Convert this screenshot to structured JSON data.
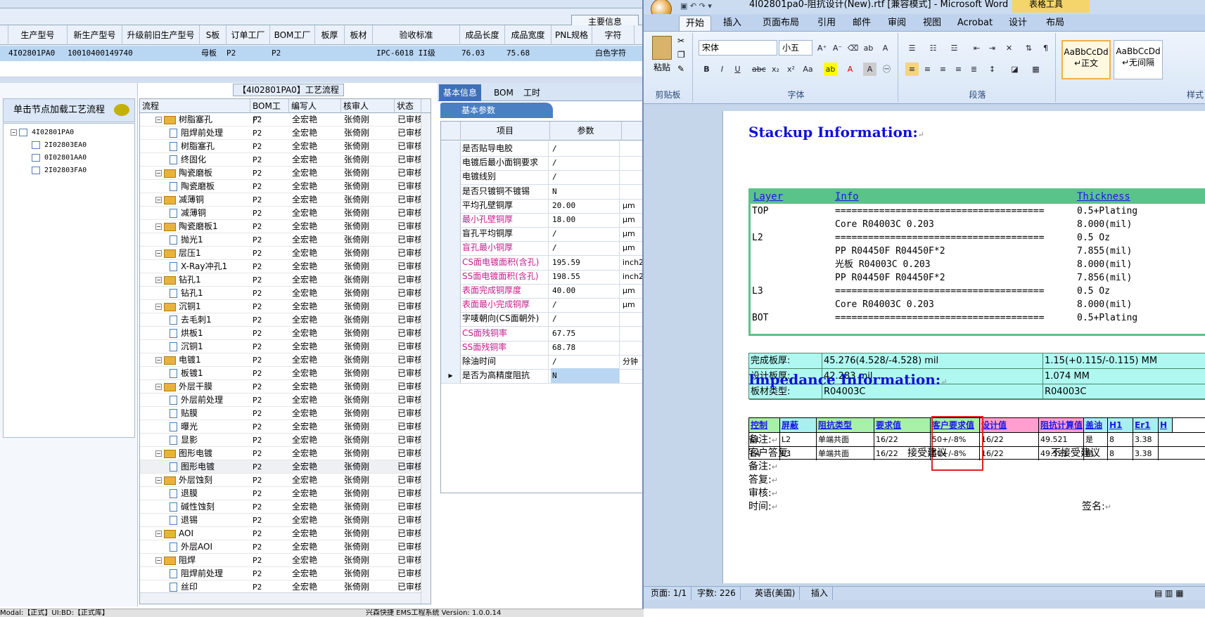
{
  "erp": {
    "info_tab": "主要信息",
    "grid_headers": [
      "生产型号",
      "新生产型号",
      "升级前旧生产型号",
      "S板",
      "订单工厂",
      "BOM工厂",
      "板厚",
      "板材",
      "验收标准",
      "成品长度",
      "成品宽度",
      "PNL规格",
      "字符"
    ],
    "grid_row": {
      "prod_model": "4I02801PA0",
      "new_model": "10010400149740",
      "s_board": "母板",
      "order_factory": "P2",
      "bom_factory": "P2",
      "standard": "IPC-6018 II级",
      "length": "76.03",
      "width": "75.68",
      "char": "白色字符"
    },
    "tree_panel": {
      "header": "单击节点加载工艺流程",
      "nodes": [
        "4I02801PA0",
        "2I02803EA0",
        "0I02801AA0",
        "2I02803FA0"
      ]
    },
    "process": {
      "title": "【4I02801PA0】工艺流程",
      "headers": [
        "流程",
        "BOM工厂",
        "编写人",
        "核审人",
        "状态"
      ],
      "factory": "P2",
      "writer": "全宏艳",
      "reviewer": "张倚刚",
      "status": "已审核",
      "rows": [
        {
          "name": "树脂塞孔",
          "level": 1
        },
        {
          "name": "阻焊前处理",
          "level": 2
        },
        {
          "name": "树脂塞孔",
          "level": 2
        },
        {
          "name": "终固化",
          "level": 2
        },
        {
          "name": "陶瓷磨板",
          "level": 1
        },
        {
          "name": "陶瓷磨板",
          "level": 2
        },
        {
          "name": "减薄铜",
          "level": 1
        },
        {
          "name": "减薄铜",
          "level": 2
        },
        {
          "name": "陶瓷磨板1",
          "level": 1
        },
        {
          "name": "抛光1",
          "level": 2
        },
        {
          "name": "层压1",
          "level": 1
        },
        {
          "name": "X-Ray冲孔1",
          "level": 2
        },
        {
          "name": "钻孔1",
          "level": 1
        },
        {
          "name": "钻孔1",
          "level": 2
        },
        {
          "name": "沉铜1",
          "level": 1
        },
        {
          "name": "去毛刺1",
          "level": 2
        },
        {
          "name": "烘板1",
          "level": 2
        },
        {
          "name": "沉铜1",
          "level": 2
        },
        {
          "name": "电镀1",
          "level": 1
        },
        {
          "name": "板镀1",
          "level": 2
        },
        {
          "name": "外层干膜",
          "level": 1
        },
        {
          "name": "外层前处理",
          "level": 2
        },
        {
          "name": "贴膜",
          "level": 2
        },
        {
          "name": "曝光",
          "level": 2
        },
        {
          "name": "显影",
          "level": 2
        },
        {
          "name": "图形电镀",
          "level": 1
        },
        {
          "name": "图形电镀",
          "level": 2
        },
        {
          "name": "外层蚀刻",
          "level": 1
        },
        {
          "name": "退膜",
          "level": 2
        },
        {
          "name": "碱性蚀刻",
          "level": 2
        },
        {
          "name": "退锡",
          "level": 2
        },
        {
          "name": "AOI",
          "level": 1
        },
        {
          "name": "外层AOI",
          "level": 2
        },
        {
          "name": "阻焊",
          "level": 1
        },
        {
          "name": "阻焊前处理",
          "level": 2
        },
        {
          "name": "丝印",
          "level": 2
        }
      ]
    },
    "params": {
      "tabs": [
        "基本信息",
        "BOM",
        "工时"
      ],
      "subtab": "基本参数",
      "headers": [
        "项目",
        "参数"
      ],
      "rows": [
        {
          "k": "是否贴导电胶",
          "v": "/",
          "u": "",
          "pink": false
        },
        {
          "k": "电镀后最小面铜要求",
          "v": "/",
          "u": "",
          "pink": false
        },
        {
          "k": "电镀线别",
          "v": "/",
          "u": "",
          "pink": false
        },
        {
          "k": "是否只镀铜不镀锡",
          "v": "N",
          "u": "",
          "pink": false
        },
        {
          "k": "平均孔壁铜厚",
          "v": "20.00",
          "u": "μm",
          "pink": false
        },
        {
          "k": "最小孔壁铜厚",
          "v": "18.00",
          "u": "μm",
          "pink": true
        },
        {
          "k": "盲孔平均铜厚",
          "v": "/",
          "u": "μm",
          "pink": false
        },
        {
          "k": "盲孔最小铜厚",
          "v": "/",
          "u": "μm",
          "pink": true
        },
        {
          "k": "CS面电镀面积(含孔)",
          "v": "195.59",
          "u": "inch2",
          "pink": true
        },
        {
          "k": "SS面电镀面积(含孔)",
          "v": "198.55",
          "u": "inch2",
          "pink": true
        },
        {
          "k": "表面完成铜厚度",
          "v": "40.00",
          "u": "μm",
          "pink": true
        },
        {
          "k": "表面最小完成铜厚",
          "v": "/",
          "u": "μm",
          "pink": true
        },
        {
          "k": "字唛朝向(CS面朝外)",
          "v": "/",
          "u": "",
          "pink": false
        },
        {
          "k": "CS面残铜率",
          "v": "67.75",
          "u": "",
          "pink": true
        },
        {
          "k": "SS面残铜率",
          "v": "68.78",
          "u": "",
          "pink": true
        },
        {
          "k": "除油时间",
          "v": "/",
          "u": "分钟",
          "pink": false
        },
        {
          "k": "是否为高精度阻抗",
          "v": "N",
          "u": "",
          "pink": false
        }
      ]
    },
    "status_left": "Modal:【正式】UI:BD:【正式库】",
    "status_mid": "兴森快捷 EMS工程系统 Version: 1.0.0.14"
  },
  "word": {
    "title": "4I02801pa0-阻抗设计(New).rtf [兼容模式] - Microsoft Word",
    "table_tools": "表格工具",
    "tabs": [
      "开始",
      "插入",
      "页面布局",
      "引用",
      "邮件",
      "审阅",
      "视图",
      "Acrobat",
      "设计",
      "布局"
    ],
    "ribbon": {
      "paste": "粘贴",
      "clipboard": "剪贴板",
      "font_name": "宋体",
      "font_size": "小五",
      "font_group": "字体",
      "para_group": "段落",
      "style_group": "样式",
      "style1_sample": "AaBbCcDd",
      "style1_name": "↵正文",
      "style2_sample": "AaBbCcDd",
      "style2_name": "↵无间隔"
    },
    "doc": {
      "stack_title": "Stackup Information:",
      "stack_headers": [
        "Layer",
        "Info",
        "Thickness"
      ],
      "stack_rows": [
        {
          "layer": "TOP",
          "info": "======================================",
          "thk": "0.5+Plating"
        },
        {
          "layer": "",
          "info": "Core     R04003C    0.203",
          "thk": "8.000(mil)"
        },
        {
          "layer": "L2",
          "info": "======================================",
          "thk": "0.5 Oz"
        },
        {
          "layer": "",
          "info": "PP    R04450F    R04450F*2",
          "thk": "7.855(mil)"
        },
        {
          "layer": "",
          "info": "光板    R04003C    0.203",
          "thk": "8.000(mil)"
        },
        {
          "layer": "",
          "info": "PP    R04450F    R04450F*2",
          "thk": "7.856(mil)"
        },
        {
          "layer": "L3",
          "info": "======================================",
          "thk": "0.5 Oz"
        },
        {
          "layer": "",
          "info": "Core     R04003C    0.203",
          "thk": "8.000(mil)"
        },
        {
          "layer": "BOT",
          "info": "======================================",
          "thk": "0.5+Plating"
        }
      ],
      "board_rows": [
        {
          "k": "完成板厚:",
          "v": "45.276(4.528/-4.528) mil",
          "w": "1.15(+0.115/-0.115) MM"
        },
        {
          "k": "设计板厚:",
          "v": "42.283 mil",
          "w": "1.074 MM"
        },
        {
          "k": "板材类型:",
          "v": "R04003C",
          "w": "R04003C"
        }
      ],
      "imp_title": "Impedance Information:",
      "imp_headers": [
        "控制",
        "屏蔽",
        "阻抗类型",
        "要求值",
        "客户要求值",
        "设计值",
        "阻抗计算值",
        "盖油",
        "H1",
        "Er1",
        "H"
      ],
      "imp_rows": [
        [
          "L1",
          "L2",
          "单端共面",
          "16/22",
          "50+/-8%",
          "16/22",
          "49.521",
          "是",
          "8",
          "3.38"
        ],
        [
          "L4",
          "L3",
          "单端共面",
          "16/22",
          "50+/-8%",
          "16/22",
          "49.521",
          "是",
          "8",
          "3.38"
        ]
      ],
      "notes": {
        "remark": "备注:",
        "reply": "客户答复:",
        "accept": "接受建议",
        "reject": "不接受建议",
        "remark2": "备注:",
        "answer": "答复:",
        "audit": "审核:",
        "time": "时间:",
        "sign": "签名:"
      }
    },
    "status": {
      "page": "页面: 1/1",
      "words": "字数: 226",
      "lang": "英语(美国)",
      "mode": "插入"
    }
  }
}
